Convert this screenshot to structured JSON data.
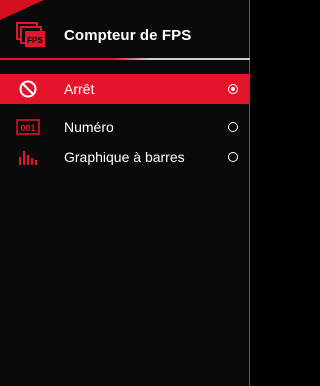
{
  "header": {
    "icon": "fps-counter-icon",
    "icon_text": "FPS",
    "title": "Compteur de FPS"
  },
  "options": [
    {
      "label": "Arrêt",
      "icon": "prohibited-icon",
      "selected": true
    },
    {
      "label": "Numéro",
      "icon": "numeric-display-icon",
      "icon_text": "001",
      "selected": false
    },
    {
      "label": "Graphique à barres",
      "icon": "bar-graph-icon",
      "selected": false
    }
  ],
  "colors": {
    "accent": "#e4142a",
    "background": "#0a0a0a",
    "text": "#ffffff"
  }
}
